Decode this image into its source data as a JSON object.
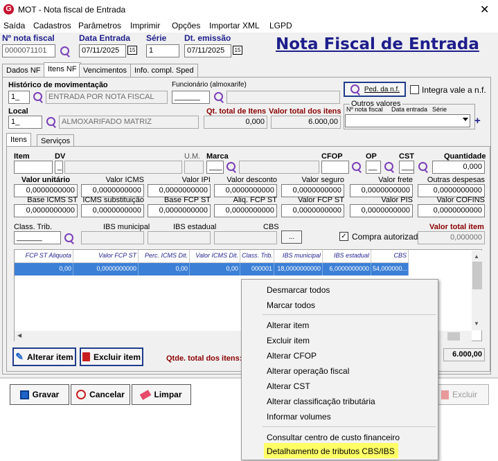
{
  "window": {
    "title": "MOT - Nota fiscal de Entrada",
    "close": "✕"
  },
  "menu": [
    "Saída",
    "Cadastros",
    "Parâmetros",
    "Imprimir",
    "Opções",
    "Importar XML",
    "LGPD"
  ],
  "header": {
    "nf_label": "Nº nota fiscal",
    "nf_value": "0000071101",
    "data_entrada_label": "Data Entrada",
    "data_entrada_value": "07/11/2025",
    "serie_label": "Série",
    "serie_value": "1",
    "dt_emissao_label": "Dt. emissão",
    "dt_emissao_value": "07/11/2025",
    "big_title": "Nota Fiscal de Entrada"
  },
  "tabs": [
    "Dados NF",
    "Itens NF",
    "Vencimentos",
    "Info. compl. Sped"
  ],
  "itens_nf": {
    "historico_label": "Histórico de movimentação",
    "historico_code": "1_",
    "historico_desc": "ENTRADA POR NOTA FISCAL",
    "funcionario_label": "Funcionário (almoxarife)",
    "funcionario_code": "______",
    "ped_nf_label": "Ped. da n.f.",
    "integra_label": "Integra vale a n.f.",
    "local_label": "Local",
    "local_code": "1_",
    "local_desc": "ALMOXARIFADO MATRIZ",
    "qt_total_label": "Qt. total de Itens",
    "qt_total_value": "0,000",
    "valor_total_label": "Valor total dos itens",
    "valor_total_value": "6.000,00",
    "outros_valores_label": "Outros valores",
    "nf_col": "Nº nota fiscal",
    "data_col": "Data entrada",
    "serie_col": "Série",
    "plus": "+"
  },
  "subtabs": [
    "Itens",
    "Serviços"
  ],
  "item": {
    "item_label": "Item",
    "dv_label": "DV",
    "dv_value": "_",
    "um_label": "U.M.",
    "marca_label": "Marca",
    "marca_value": "___",
    "cfop_label": "CFOP",
    "op_label": "OP",
    "op_value": "__",
    "cst_label": "CST",
    "cst_value": "___",
    "quantidade_label": "Quantidade",
    "quantidade_value": "0,000",
    "row1": [
      {
        "label": "Valor unitário",
        "value": "0,0000000000"
      },
      {
        "label": "Valor ICMS",
        "value": "0,0000000000"
      },
      {
        "label": "Valor IPI",
        "value": "0,0000000000"
      },
      {
        "label": "Valor desconto",
        "value": "0,0000000000"
      },
      {
        "label": "Valor seguro",
        "value": "0,0000000000"
      },
      {
        "label": "Valor frete",
        "value": "0,0000000000"
      },
      {
        "label": "Outras despesas",
        "value": "0,0000000000"
      }
    ],
    "row2": [
      {
        "label": "Base ICMS ST",
        "value": "0,0000000000"
      },
      {
        "label": "ICMS substituição",
        "value": "0,0000000000"
      },
      {
        "label": "Base FCP ST",
        "value": "0,0000000000"
      },
      {
        "label": "Aliq. FCP ST",
        "value": "0,0000000000"
      },
      {
        "label": "Valor FCP ST",
        "value": "0,0000000000"
      },
      {
        "label": "Valor PIS",
        "value": "0,0000000000"
      },
      {
        "label": "Valor COFINS",
        "value": "0,0000000000"
      }
    ],
    "class_trib_label": "Class. Trib.",
    "class_trib_value": "______",
    "ibs_mun_label": "IBS municipal",
    "ibs_est_label": "IBS estadual",
    "cbs_label": "CBS",
    "ellipsis": "...",
    "compra_label": "Compra autorizada",
    "valor_total_item_label": "Valor total item",
    "valor_total_item_value": "0,000000"
  },
  "grid": {
    "headers": [
      "FCP ST Aliquota",
      "Valor FCP ST",
      "Perc. ICMS Dit.",
      "Valor ICMS Dit.",
      "Class. Trib.",
      "IBS municipal",
      "IBS estadual",
      "CBS"
    ],
    "row": [
      "0,00",
      "0,0000000000",
      "0,00",
      "0,00",
      "000001",
      "18,0000000000",
      "6,0000000000",
      "54,000000..."
    ]
  },
  "buttons": {
    "alterar_item": "Alterar item",
    "excluir_item": "Excluir item",
    "qtde_total_label": "Qtde. total dos itens:",
    "total_value": "6.000,00",
    "gravar": "Gravar",
    "cancelar": "Cancelar",
    "limpar": "Limpar",
    "excluir": "Excluir"
  },
  "context_menu": {
    "group1": [
      "Desmarcar todos",
      "Marcar todos"
    ],
    "group2": [
      "Alterar item",
      "Excluir item",
      "Alterar CFOP",
      "Alterar operação fiscal",
      "Alterar CST",
      "Alterar classificação tributária",
      "Informar volumes"
    ],
    "group3": [
      "Consultar centro de custo financeiro",
      "Detalhamento de tributos CBS/IBS"
    ]
  },
  "colors": {
    "accent": "#1e1e8c",
    "highlight": "#ffff66",
    "selection": "#3b7fd6"
  }
}
